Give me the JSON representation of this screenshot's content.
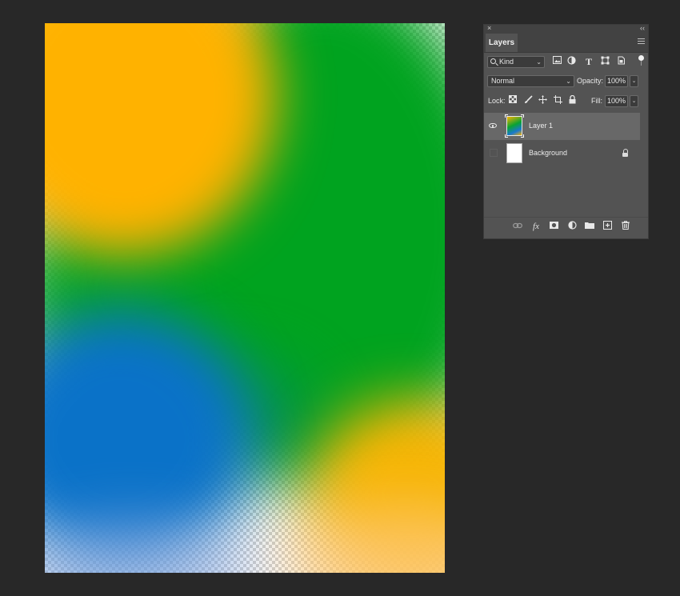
{
  "panel": {
    "close_glyph": "×",
    "collapse_glyph": "‹‹",
    "tab_label": "Layers",
    "filter": {
      "kind_label": "Kind",
      "icons": [
        "pixel-filter-icon",
        "adjustment-filter-icon",
        "type-filter-icon",
        "shape-filter-icon",
        "smart-object-filter-icon"
      ]
    },
    "blend_mode": "Normal",
    "opacity_label": "Opacity:",
    "opacity_value": "100%",
    "lock_label": "Lock:",
    "fill_label": "Fill:",
    "fill_value": "100%",
    "layers": [
      {
        "name": "Layer 1",
        "visible": true,
        "selected": true
      },
      {
        "name": "Background",
        "visible": false,
        "locked": true
      }
    ],
    "bottom_icons": [
      "link-icon",
      "fx-icon",
      "mask-icon",
      "adjustment-layer-icon",
      "folder-icon",
      "new-layer-icon",
      "trash-icon"
    ],
    "fx_text": "fx"
  },
  "colors": {
    "workspace": "#282828",
    "panel": "#535353",
    "canvas_green": "#00a31f",
    "canvas_yellow": "#ffb200",
    "canvas_blue": "#0a72c8"
  }
}
